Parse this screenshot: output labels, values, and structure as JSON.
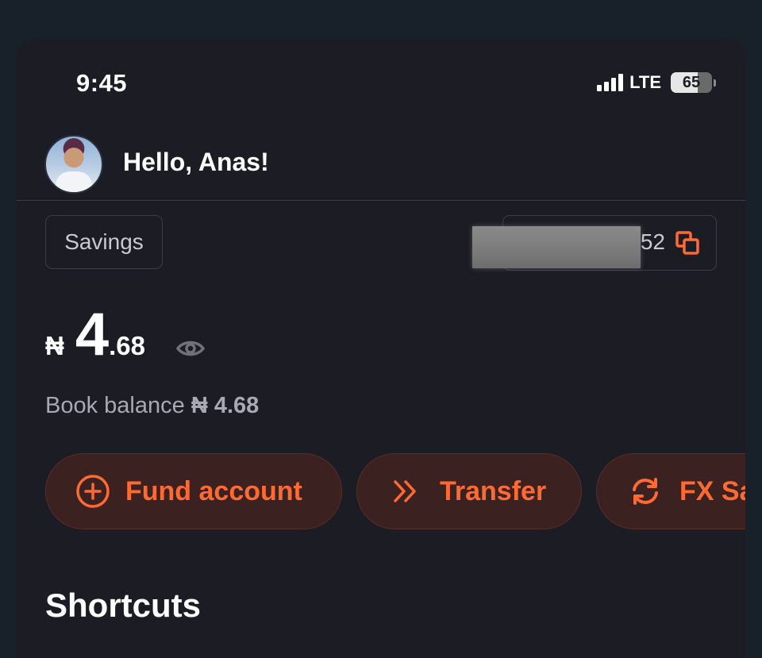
{
  "status_bar": {
    "time": "9:45",
    "network": "LTE",
    "battery": "65",
    "battery_level": 0.65
  },
  "header": {
    "greeting": "Hello, Anas!"
  },
  "account": {
    "type_label": "Savings",
    "number_suffix": "52"
  },
  "balance": {
    "currency": "₦",
    "whole": "4",
    "fraction": ".68",
    "book_label": "Book balance",
    "book_amount": "₦ 4.68"
  },
  "actions": [
    {
      "label": "Fund account",
      "icon": "plus-circle-icon"
    },
    {
      "label": "Transfer",
      "icon": "double-chevron-right-icon"
    },
    {
      "label": "FX Sa",
      "icon": "exchange-arrows-icon"
    }
  ],
  "sections": {
    "shortcuts_title": "Shortcuts"
  },
  "colors": {
    "accent": "#ff6a33",
    "pill_background": "#3b2220",
    "card_background": "#1b1c24",
    "page_background": "#18202a"
  }
}
